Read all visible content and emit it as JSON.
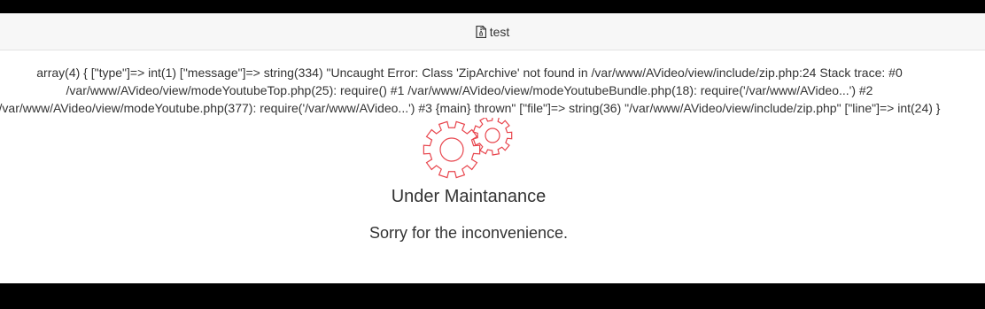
{
  "header": {
    "title": "test",
    "icon": "file-zip-icon"
  },
  "error": {
    "lines": [
      "array(4) { [\"type\"]=> int(1) [\"message\"]=> string(334) \"Uncaught Error: Class 'ZipArchive' not found in /var/www/AVideo/view/include/zip.php:24 Stack trace: #0",
      "/var/www/AVideo/view/modeYoutubeTop.php(25): require() #1 /var/www/AVideo/view/modeYoutubeBundle.php(18): require('/var/www/AVideo...') #2",
      "/var/www/AVideo/view/modeYoutube.php(377): require('/var/www/AVideo...') #3 {main} thrown\" [\"file\"]=> string(36) \"/var/www/AVideo/view/include/zip.php\" [\"line\"]=> int(24) }"
    ]
  },
  "maintenance": {
    "icon": "gears-icon",
    "accent_color": "#e8454d",
    "title": "Under Maintanance",
    "message": "Sorry for the inconvenience."
  }
}
